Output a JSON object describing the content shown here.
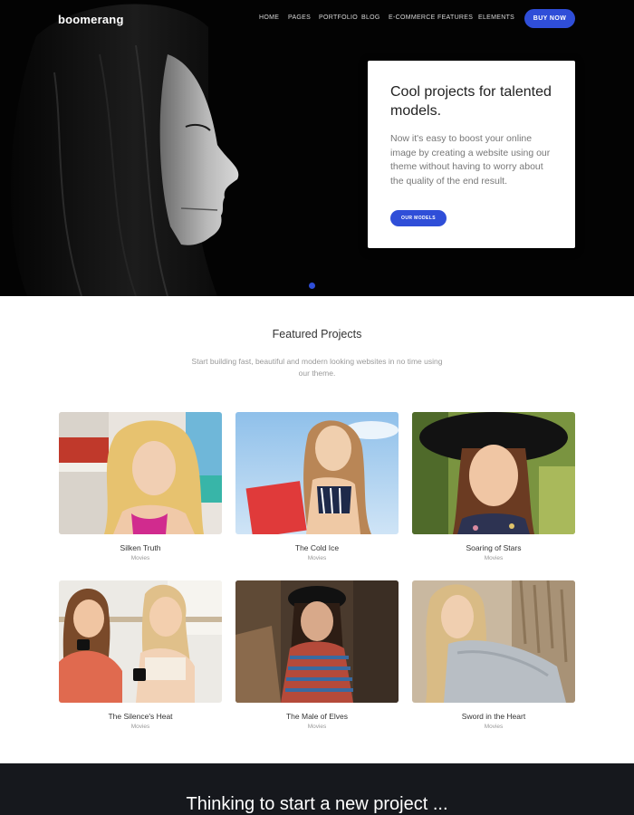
{
  "brand": {
    "name": "boomerang"
  },
  "nav": {
    "items": [
      "HOME",
      "PAGES",
      "PORTFOLIO",
      "BLOG",
      "E-COMMERCE",
      "FEATURES",
      "ELEMENTS"
    ],
    "cta_label": "BUY NOW"
  },
  "hero": {
    "title": "Cool projects for talented models.",
    "text": "Now it's easy to boost your online image by creating a website using our theme without having to worry about the quality of the end result.",
    "button_label": "OUR MODELS",
    "slide_count": 1
  },
  "featured": {
    "title": "Featured Projects",
    "subtitle": "Start building fast, beautiful and modern looking websites in no time using our theme.",
    "projects": [
      {
        "title": "Silken Truth",
        "category": "Movies"
      },
      {
        "title": "The Cold Ice",
        "category": "Movies"
      },
      {
        "title": "Soaring of Stars",
        "category": "Movies"
      },
      {
        "title": "The Silence's Heat",
        "category": "Movies"
      },
      {
        "title": "The Male of Elves",
        "category": "Movies"
      },
      {
        "title": "Sword in the Heart",
        "category": "Movies"
      }
    ]
  },
  "cta": {
    "title": "Thinking to start a new project ..."
  },
  "colors": {
    "accent": "#2f4ed8",
    "hero_bg": "#030303",
    "cta_bg": "#16181d"
  }
}
